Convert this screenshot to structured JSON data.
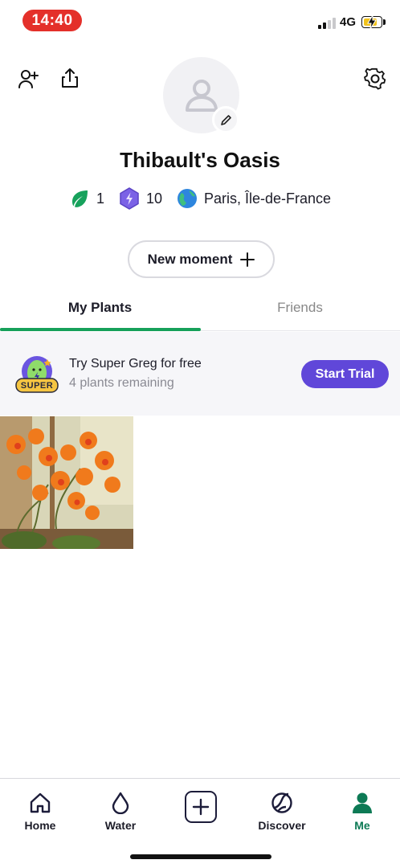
{
  "status_bar": {
    "time": "14:40",
    "network": "4G"
  },
  "profile": {
    "name": "Thibault's Oasis",
    "stats": {
      "plants": "1",
      "level": "10",
      "location": "Paris, Île-de-France"
    }
  },
  "actions": {
    "new_moment": "New moment"
  },
  "tabs": [
    {
      "label": "My Plants",
      "active": true
    },
    {
      "label": "Friends",
      "active": false
    }
  ],
  "promo": {
    "title": "Try Super Greg for free",
    "subtitle": "4 plants remaining",
    "badge": "SUPER",
    "button": "Start Trial"
  },
  "bottom_nav": [
    {
      "label": "Home",
      "icon": "home-icon"
    },
    {
      "label": "Water",
      "icon": "water-drop-icon"
    },
    {
      "label": "",
      "icon": "add-plus-icon"
    },
    {
      "label": "Discover",
      "icon": "discover-icon"
    },
    {
      "label": "Me",
      "icon": "person-icon",
      "active": true
    }
  ],
  "colors": {
    "accent_green": "#16a05a",
    "trial_purple": "#6047d9",
    "status_red": "#e4302a",
    "me_green": "#0d7a55"
  }
}
